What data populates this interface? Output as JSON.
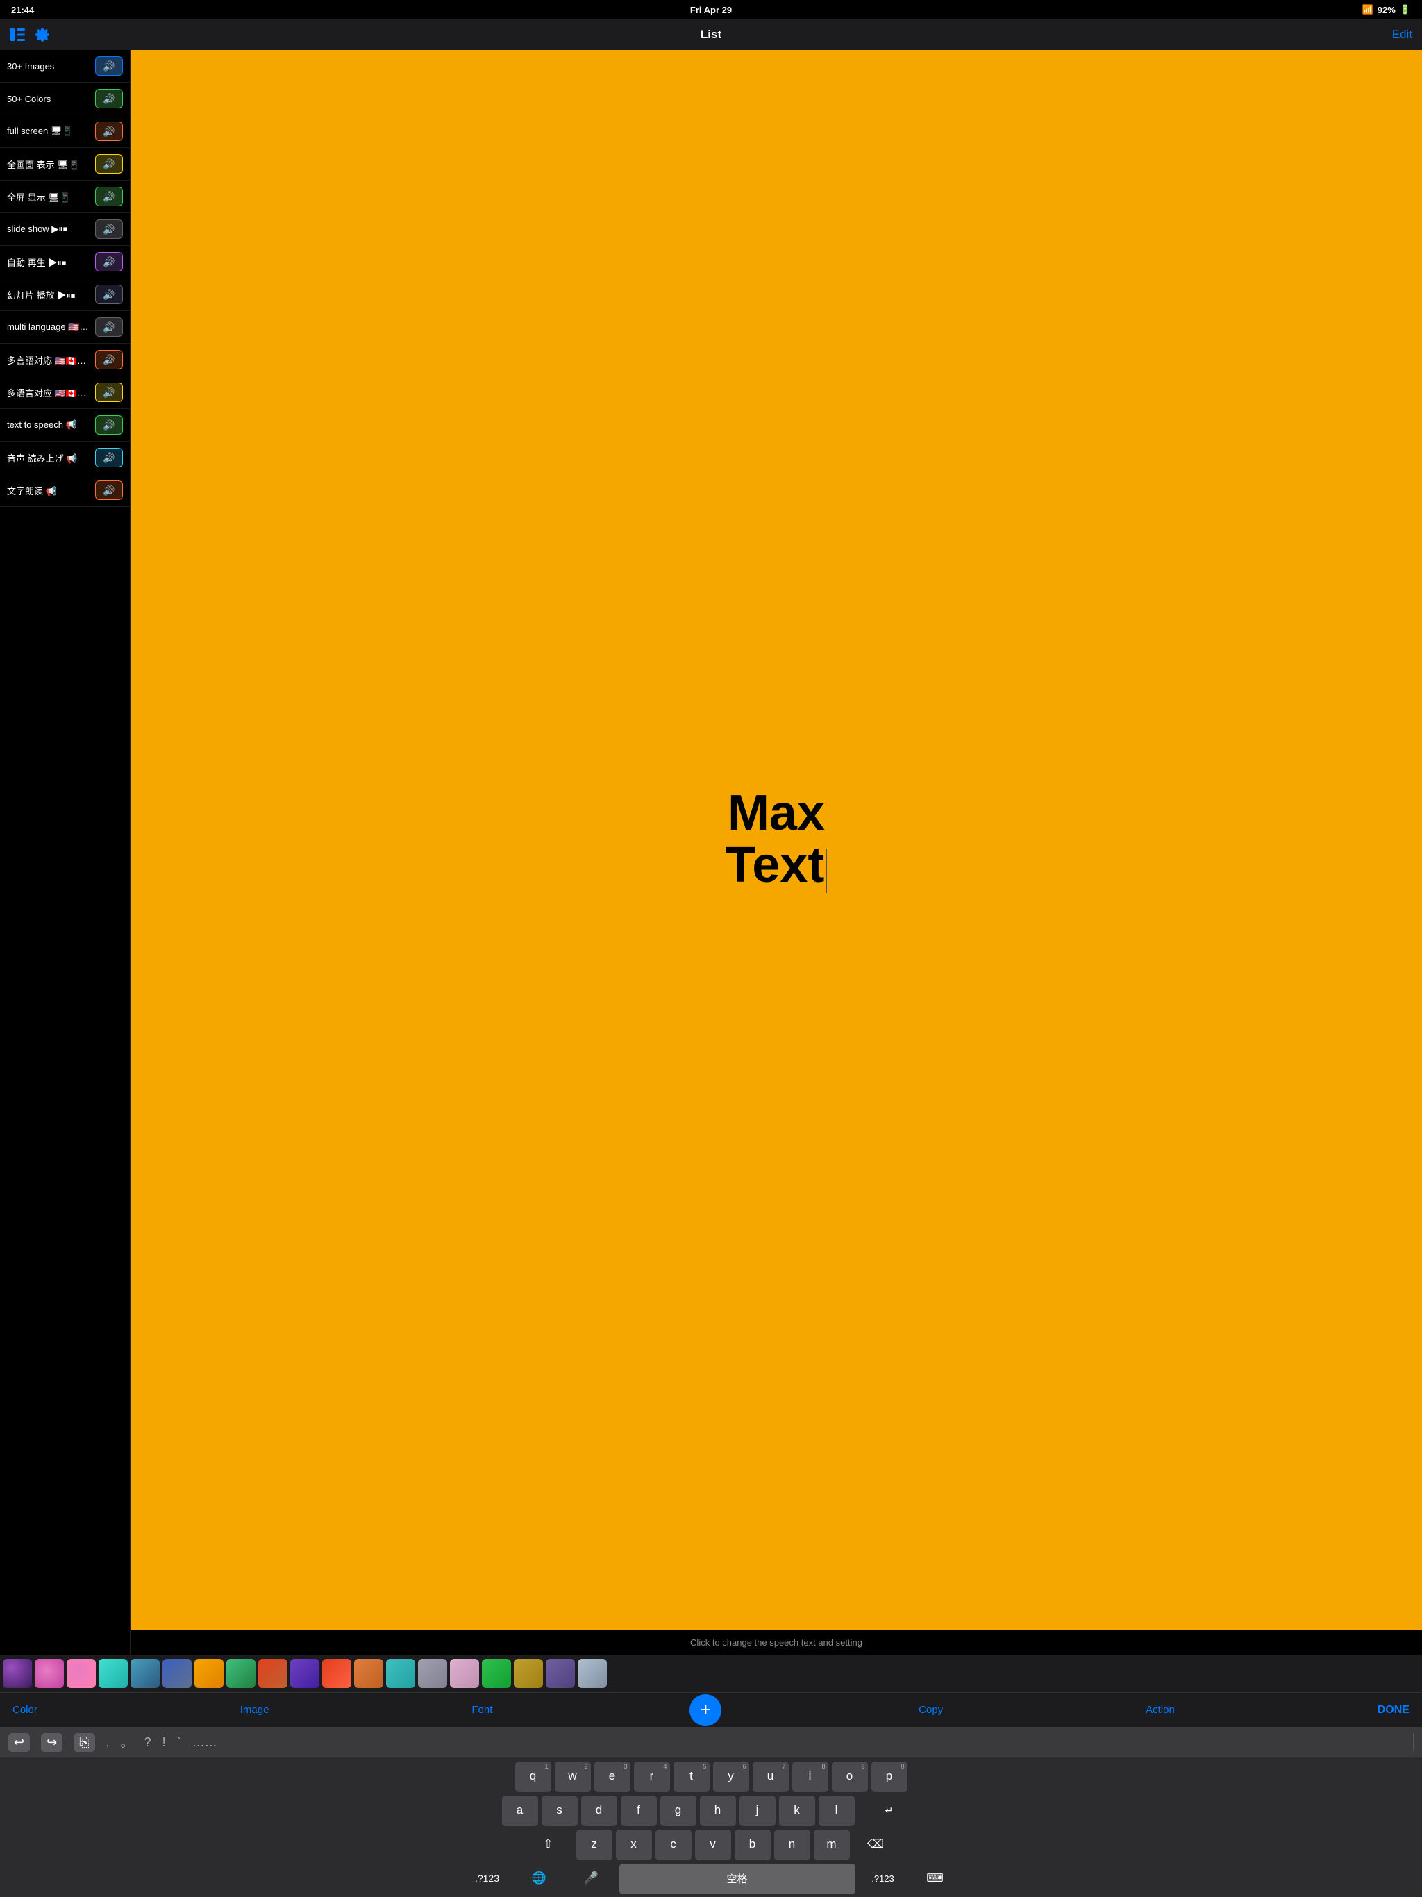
{
  "statusBar": {
    "time": "21:44",
    "date": "Fri Apr 29",
    "wifi": "wifi",
    "battery": "92%"
  },
  "navBar": {
    "title": "List",
    "editLabel": "Edit"
  },
  "listItems": [
    {
      "id": 1,
      "label": "30+ Images",
      "btnColor": "#007aff",
      "btnBg": "#1c3a5e"
    },
    {
      "id": 2,
      "label": "50+ Colors",
      "btnColor": "#30d158",
      "btnBg": "#1a3a1a"
    },
    {
      "id": 3,
      "label": "full screen 🖥📱",
      "btnColor": "#ff6b35",
      "btnBg": "#3a1a0a"
    },
    {
      "id": 4,
      "label": "全画面 表示 🖥📱",
      "btnColor": "#ffd60a",
      "btnBg": "#3a350a"
    },
    {
      "id": 5,
      "label": "全屏 显示 🖥📱",
      "btnColor": "#30d158",
      "btnBg": "#1a3a1a"
    },
    {
      "id": 6,
      "label": "slide show ▶⏸⏹",
      "btnColor": "#636366",
      "btnBg": "#2c2c2e"
    },
    {
      "id": 7,
      "label": "自動 再生 ▶⏸⏹",
      "btnColor": "#bf5af2",
      "btnBg": "#2a1a3a"
    },
    {
      "id": 8,
      "label": "幻灯片 播放 ▶⏸⏹",
      "btnColor": "#636366",
      "btnBg": "#1a1a2a"
    },
    {
      "id": 9,
      "label": "multi language 🇺🇸🇨🇦🇬🇧🇨🇳...",
      "btnColor": "#636366",
      "btnBg": "#2c2c2e"
    },
    {
      "id": 10,
      "label": "多言語対応 🇺🇸🇨🇦🇬🇧🇨🇳🇯🇵🇭🇰",
      "btnColor": "#ff6b35",
      "btnBg": "#3a1a0a"
    },
    {
      "id": 11,
      "label": "多语言对应 🇺🇸🇨🇦🇬🇧🇨🇳🇯🇵🇭🇰",
      "btnColor": "#ffd60a",
      "btnBg": "#3a350a"
    },
    {
      "id": 12,
      "label": "text to speech 📢",
      "btnColor": "#30d158",
      "btnBg": "#1a3a1a"
    },
    {
      "id": 13,
      "label": "音声 読み上げ 📢",
      "btnColor": "#32d2f0",
      "btnBg": "#0a2a3a"
    },
    {
      "id": 14,
      "label": "文字朗读 📢",
      "btnColor": "#ff6b35",
      "btnBg": "#3a1a0a"
    }
  ],
  "preview": {
    "text": "Max\nText",
    "bgColor": "#f5a700",
    "hint": "Click to change the speech text and setting"
  },
  "colorSwatches": [
    "#6b3fa0",
    "#e87cc3",
    "#e87cc3",
    "#40e0d0",
    "#4a8fa0",
    "#5a7abf",
    "#f5a700",
    "#40c080",
    "#e05020",
    "#8040c0",
    "#e05020",
    "#e08040",
    "#40c0c0",
    "#b0b0c0",
    "#e0b0d0",
    "#30c050",
    "#c0a030",
    "#7060a0",
    "#b0c0d0"
  ],
  "toolbar": {
    "colorLabel": "Color",
    "imageLabel": "Image",
    "fontLabel": "Font",
    "plusLabel": "+",
    "copyLabel": "Copy",
    "actionLabel": "Action",
    "doneLabel": "DONE"
  },
  "keyboard": {
    "row1": [
      "q",
      "w",
      "e",
      "r",
      "t",
      "y",
      "u",
      "i",
      "o",
      "p"
    ],
    "row1nums": [
      "1",
      "2",
      "3",
      "4",
      "5",
      "6",
      "7",
      "8",
      "9",
      "0"
    ],
    "row2": [
      "a",
      "s",
      "d",
      "f",
      "g",
      "h",
      "j",
      "k",
      "l"
    ],
    "row3": [
      "z",
      "x",
      "c",
      "v",
      "b",
      "n",
      "m"
    ],
    "spaceLabel": "空格",
    "accessories": [
      "↩",
      "→",
      "⎘",
      ",",
      "。",
      "?",
      "!",
      "`",
      "……"
    ]
  }
}
